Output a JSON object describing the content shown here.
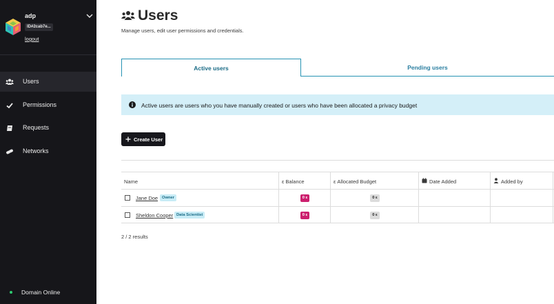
{
  "domain": {
    "name": "adp",
    "id_badge": "ID#2cab7e...",
    "logout_label": "logout"
  },
  "sidebar": {
    "items": [
      {
        "label": "Users",
        "icon": "users-icon",
        "active": true
      },
      {
        "label": "Permissions",
        "icon": "check-icon",
        "active": false
      },
      {
        "label": "Requests",
        "icon": "requests-icon",
        "active": false
      },
      {
        "label": "Networks",
        "icon": "networks-icon",
        "active": false
      }
    ],
    "status_label": "Domain Online",
    "status_color": "#2ecc71"
  },
  "page": {
    "title": "Users",
    "subtitle": "Manage users, edit user permissions and credentials."
  },
  "tabs": [
    {
      "label": "Active users",
      "active": true
    },
    {
      "label": "Pending users",
      "active": false
    }
  ],
  "banner": {
    "text": "Active users are users who you have manually created or users who have been allocated a privacy budget"
  },
  "create_button": {
    "label": "Create User"
  },
  "table": {
    "headers": {
      "name": "Name",
      "balance": "ε Balance",
      "allocated": "ε Allocated Budget",
      "date_added": "Date Added",
      "added_by": "Added by"
    },
    "rows": [
      {
        "name": "Jane Doe",
        "role": "Owner",
        "balance": "0 ε",
        "allocated": "0 ε",
        "date_added": "",
        "added_by": ""
      },
      {
        "name": "Sheldon Cooper",
        "role": "Data Scientist",
        "balance": "0 ε",
        "allocated": "0 ε",
        "date_added": "",
        "added_by": ""
      }
    ]
  },
  "results_text": "2 / 2 results",
  "colors": {
    "sidebar_bg": "#16161a",
    "accent": "#2592b3",
    "banner_bg": "#d4eff8",
    "balance_pill": "#cc1f6e",
    "badge_bg": "#c8ecf6"
  }
}
